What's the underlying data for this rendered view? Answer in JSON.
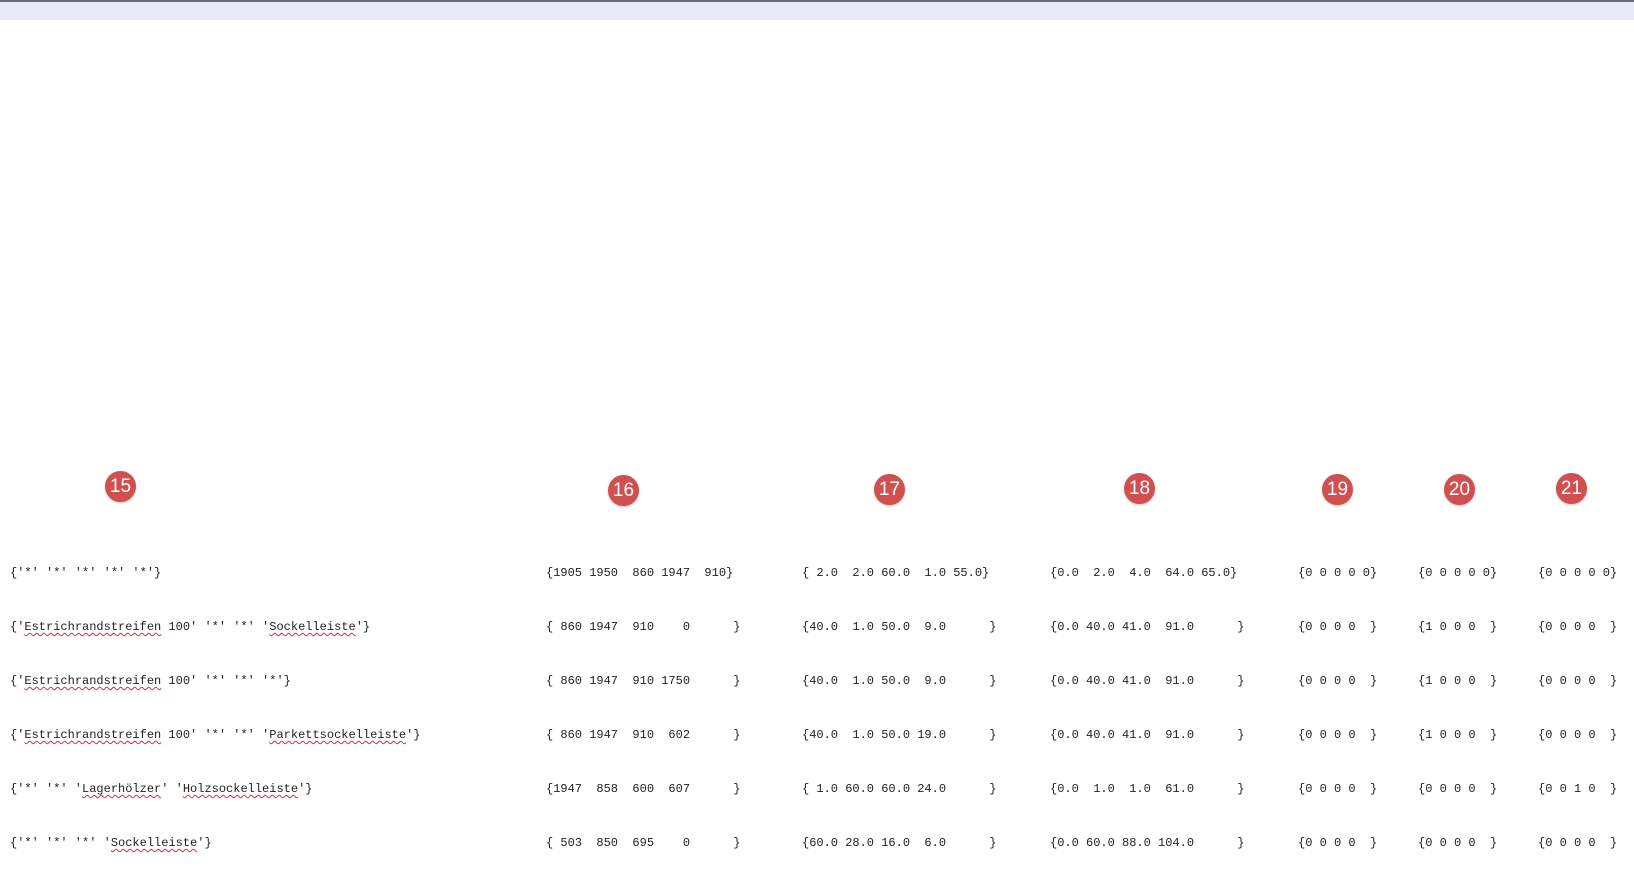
{
  "markers": [
    "15",
    "16",
    "17",
    "18",
    "19",
    "20",
    "21"
  ],
  "rows": [
    {
      "c15": [
        "{'*' '*' '*' '*' '*'}"
      ],
      "c16": "{1905 1950  860 1947  910}",
      "c17": "{ 2.0  2.0 60.0  1.0 55.0}",
      "c18": "{0.0  2.0  4.0  64.0 65.0}",
      "c19": "{0 0 0 0 0}",
      "c20": "{0 0 0 0 0}",
      "c21": "{0 0 0 0 0}"
    },
    {
      "c15": [
        "{'",
        "Estrichrandstreifen",
        " 100' '*' '*' '",
        "Sockelleiste",
        "'}"
      ],
      "c16": "{ 860 1947  910    0      }",
      "c17": "{40.0  1.0 50.0  9.0      }",
      "c18": "{0.0 40.0 41.0  91.0      }",
      "c19": "{0 0 0 0  }",
      "c20": "{1 0 0 0  }",
      "c21": "{0 0 0 0  }"
    },
    {
      "c15": [
        "{'",
        "Estrichrandstreifen",
        " 100' '*' '*' '*'}"
      ],
      "c16": "{ 860 1947  910 1750      }",
      "c17": "{40.0  1.0 50.0  9.0      }",
      "c18": "{0.0 40.0 41.0  91.0      }",
      "c19": "{0 0 0 0  }",
      "c20": "{1 0 0 0  }",
      "c21": "{0 0 0 0  }"
    },
    {
      "c15": [
        "{'",
        "Estrichrandstreifen",
        " 100' '*' '*' '",
        "Parkettsockelleiste",
        "'}"
      ],
      "c16": "{ 860 1947  910  602      }",
      "c17": "{40.0  1.0 50.0 19.0      }",
      "c18": "{0.0 40.0 41.0  91.0      }",
      "c19": "{0 0 0 0  }",
      "c20": "{1 0 0 0  }",
      "c21": "{0 0 0 0  }"
    },
    {
      "c15": [
        "{'*' '*' '",
        "Lagerhölzer",
        "' '",
        "Holzsockelleiste",
        "'}"
      ],
      "c16": "{1947  858  600  607      }",
      "c17": "{ 1.0 60.0 60.0 24.0      }",
      "c18": "{0.0  1.0  1.0  61.0      }",
      "c19": "{0 0 0 0  }",
      "c20": "{0 0 0 0  }",
      "c21": "{0 0 1 0  }"
    },
    {
      "c15": [
        "{'*' '*' '*' '",
        "Sockelleiste",
        "'}"
      ],
      "c16": "{ 503  850  695    0      }",
      "c17": "{60.0 28.0 16.0  6.0      }",
      "c18": "{0.0 60.0 88.0 104.0      }",
      "c19": "{0 0 0 0  }",
      "c20": "{0 0 0 0  }",
      "c21": "{0 0 0 0  }"
    }
  ],
  "colors": {
    "marker": "#d05050",
    "spellcheck": "#d93030",
    "topbar": "#e8e8f8",
    "text": "#222222"
  }
}
